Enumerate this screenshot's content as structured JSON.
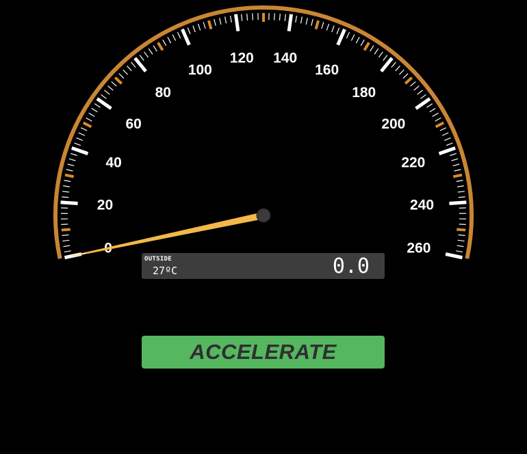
{
  "gauge": {
    "min": 0,
    "max": 260,
    "major_step": 20,
    "labels": [
      "0",
      "20",
      "40",
      "60",
      "80",
      "100",
      "120",
      "140",
      "160",
      "180",
      "200",
      "220",
      "240",
      "260"
    ],
    "current_speed": 0,
    "colors": {
      "bezel": "#c98536",
      "minor_tick_accent": "#d88a2a",
      "major_tick": "#ffffff",
      "needle": "#f2b84a",
      "hub": "#3a3a3a"
    },
    "icons": {
      "needle": "needle-icon",
      "hub": "hub-icon"
    }
  },
  "info_panel": {
    "outside_label": "OUTSIDE",
    "temperature_value": "27",
    "temperature_unit": "ºC",
    "speed_display": "0.0"
  },
  "controls": {
    "accelerate_label": "ACCELERATE",
    "accelerate_color": "#55b760"
  }
}
